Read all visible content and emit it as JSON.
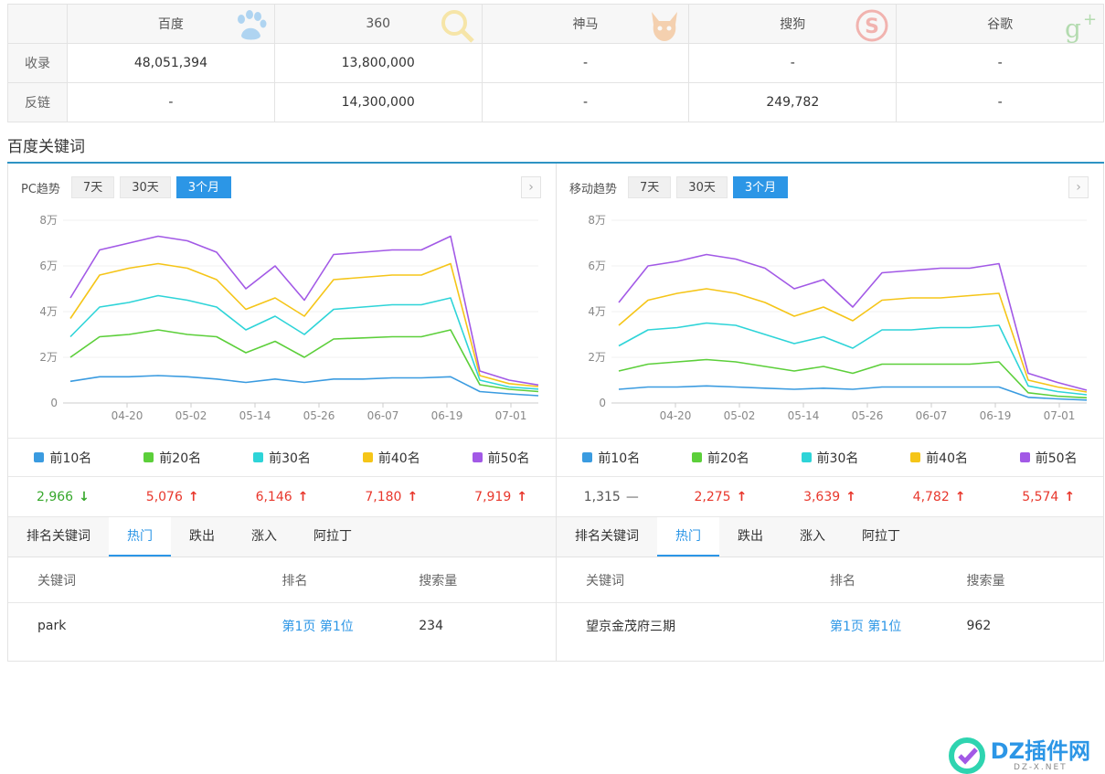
{
  "engines": {
    "headers": [
      "",
      "百度",
      "360",
      "神马",
      "搜狗",
      "谷歌"
    ],
    "logos": [
      "paw-icon",
      "magnifier-icon",
      "shenma-icon",
      "sogou-s-icon",
      "google-plus-icon"
    ],
    "rows": [
      {
        "label": "收录",
        "values": [
          "48,051,394",
          "13,800,000",
          "-",
          "-",
          "-"
        ]
      },
      {
        "label": "反链",
        "values": [
          "-",
          "14,300,000",
          "-",
          "249,782",
          "-"
        ]
      }
    ]
  },
  "section_title": "百度关键词",
  "colors": {
    "top10": "#3a9be0",
    "top20": "#5ccf3a",
    "top30": "#2ed4d8",
    "top40": "#f5c518",
    "top50": "#a259e6",
    "accent": "#2c96e6",
    "up": "#e8372c",
    "down": "#37a82c"
  },
  "panels": [
    {
      "title": "PC趋势",
      "ranges": [
        "7天",
        "30天",
        "3个月"
      ],
      "active_range": "3个月",
      "legend": [
        "前10名",
        "前20名",
        "前30名",
        "前40名",
        "前50名"
      ],
      "values": [
        {
          "v": "2,966",
          "dir": "down"
        },
        {
          "v": "5,076",
          "dir": "up"
        },
        {
          "v": "6,146",
          "dir": "up"
        },
        {
          "v": "7,180",
          "dir": "up"
        },
        {
          "v": "7,919",
          "dir": "up"
        }
      ],
      "tabs": [
        "排名关键词",
        "热门",
        "跌出",
        "涨入",
        "阿拉丁"
      ],
      "active_tab": "热门",
      "columns": [
        "关键词",
        "排名",
        "搜索量"
      ],
      "row": {
        "keyword": "park",
        "rank": "第1页 第1位",
        "volume": "234"
      }
    },
    {
      "title": "移动趋势",
      "ranges": [
        "7天",
        "30天",
        "3个月"
      ],
      "active_range": "3个月",
      "legend": [
        "前10名",
        "前20名",
        "前30名",
        "前40名",
        "前50名"
      ],
      "values": [
        {
          "v": "1,315",
          "dir": "flat"
        },
        {
          "v": "2,275",
          "dir": "up"
        },
        {
          "v": "3,639",
          "dir": "up"
        },
        {
          "v": "4,782",
          "dir": "up"
        },
        {
          "v": "5,574",
          "dir": "up"
        }
      ],
      "tabs": [
        "排名关键词",
        "热门",
        "跌出",
        "涨入",
        "阿拉丁"
      ],
      "active_tab": "热门",
      "columns": [
        "关键词",
        "排名",
        "搜索量"
      ],
      "row": {
        "keyword": "望京金茂府三期",
        "rank": "第1页 第1位",
        "volume": "962"
      }
    }
  ],
  "chart_data": [
    {
      "type": "line",
      "x_ticks": [
        "04-20",
        "05-02",
        "05-14",
        "05-26",
        "06-07",
        "06-19",
        "07-01"
      ],
      "y_ticks": [
        "0",
        "2万",
        "4万",
        "6万",
        "8万"
      ],
      "ylim": [
        0,
        80000
      ],
      "series": [
        {
          "name": "前10名",
          "values": [
            9500,
            11500,
            11500,
            12000,
            11500,
            10500,
            9000,
            10500,
            9000,
            10500,
            10500,
            11000,
            11000,
            11500,
            5000,
            4000,
            3200
          ]
        },
        {
          "name": "前20名",
          "values": [
            20000,
            29000,
            30000,
            32000,
            30000,
            29000,
            22000,
            27000,
            20000,
            28000,
            28500,
            29000,
            29000,
            32000,
            8000,
            6000,
            5000
          ]
        },
        {
          "name": "前30名",
          "values": [
            29000,
            42000,
            44000,
            47000,
            45000,
            42000,
            32000,
            38000,
            30000,
            41000,
            42000,
            43000,
            43000,
            46000,
            10000,
            7000,
            6100
          ]
        },
        {
          "name": "前40名",
          "values": [
            37000,
            56000,
            59000,
            61000,
            59000,
            54000,
            41000,
            46000,
            38000,
            54000,
            55000,
            56000,
            56000,
            61000,
            12000,
            8500,
            7200
          ]
        },
        {
          "name": "前50名",
          "values": [
            46000,
            67000,
            70000,
            73000,
            71000,
            66000,
            50000,
            60000,
            45000,
            65000,
            66000,
            67000,
            67000,
            73000,
            14000,
            10000,
            7900
          ]
        }
      ]
    },
    {
      "type": "line",
      "x_ticks": [
        "04-20",
        "05-02",
        "05-14",
        "05-26",
        "06-07",
        "06-19",
        "07-01"
      ],
      "y_ticks": [
        "0",
        "2万",
        "4万",
        "6万",
        "8万"
      ],
      "ylim": [
        0,
        80000
      ],
      "series": [
        {
          "name": "前10名",
          "values": [
            6000,
            7000,
            7000,
            7500,
            7000,
            6500,
            6000,
            6500,
            6000,
            7000,
            7000,
            7000,
            7000,
            7000,
            2500,
            1800,
            1300
          ]
        },
        {
          "name": "前20名",
          "values": [
            14000,
            17000,
            18000,
            19000,
            18000,
            16000,
            14000,
            16000,
            13000,
            17000,
            17000,
            17000,
            17000,
            18000,
            4500,
            3000,
            2300
          ]
        },
        {
          "name": "前30名",
          "values": [
            25000,
            32000,
            33000,
            35000,
            34000,
            30000,
            26000,
            29000,
            24000,
            32000,
            32000,
            33000,
            33000,
            34000,
            7500,
            5000,
            3600
          ]
        },
        {
          "name": "前40名",
          "values": [
            34000,
            45000,
            48000,
            50000,
            48000,
            44000,
            38000,
            42000,
            36000,
            45000,
            46000,
            46000,
            47000,
            48000,
            10000,
            7000,
            4800
          ]
        },
        {
          "name": "前50名",
          "values": [
            44000,
            60000,
            62000,
            65000,
            63000,
            59000,
            50000,
            54000,
            42000,
            57000,
            58000,
            59000,
            59000,
            61000,
            13000,
            9000,
            5600
          ]
        }
      ]
    }
  ],
  "watermark": {
    "text": "DZ插件网",
    "sub": "DZ-X.NET"
  }
}
